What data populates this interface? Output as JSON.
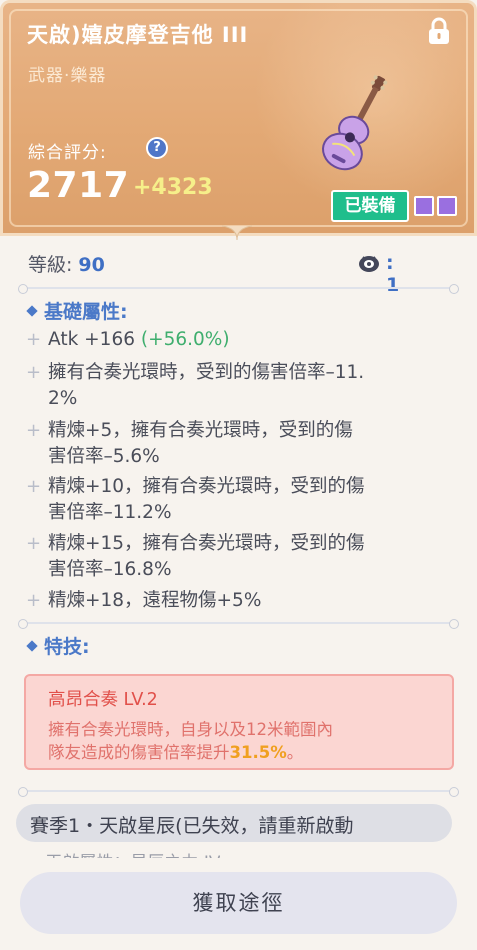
{
  "item": {
    "name": "天啟)嬉皮摩登吉他 III",
    "category": "武器·樂器",
    "score_label": "綜合評分:",
    "score": "2717",
    "score_delta": "+4323",
    "equipped_label": "已裝備",
    "help_symbol": "?"
  },
  "stats": {
    "level_label": "等級:",
    "level_value": "90",
    "gem_label": ":",
    "gem_value": "1"
  },
  "base_attrs": {
    "heading": "基礎屬性:",
    "items": [
      {
        "text": "Atk +166 ",
        "extra": "(+56.0%)"
      },
      {
        "text": "擁有合奏光環時，受到的傷害倍率–11.",
        "text2": "2%"
      },
      {
        "text": "精煉+5，擁有合奏光環時，受到的傷",
        "text2": "害倍率–5.6%"
      },
      {
        "text": "精煉+10，擁有合奏光環時，受到的傷",
        "text2": "害倍率–11.2%"
      },
      {
        "text": "精煉+15，擁有合奏光環時，受到的傷",
        "text2": "害倍率–16.8%"
      },
      {
        "text": "精煉+18，遠程物傷+5%"
      }
    ]
  },
  "skill": {
    "heading": "特技:",
    "title": "高昂合奏 LV.2",
    "desc_line1": "擁有合奏光環時，自身以及12米範圍內",
    "desc_line2": "隊友造成的傷害倍率提升",
    "desc_highlight": "31.5%",
    "desc_end": "。"
  },
  "season": {
    "text": "賽季1・天啟星辰(已失效，請重新啟動",
    "cut_text": "• 天啟屬性：星辰之力 IV"
  },
  "actions": {
    "acquire_label": "獲取途徑"
  },
  "colors": {
    "header": "#e3a975",
    "accent_blue": "#4b79c8",
    "equipped_green": "#1fbe8c",
    "skill_red": "#e1504a",
    "highlight_orange": "#f0a020",
    "slot_purple": "#9a6fe0"
  }
}
